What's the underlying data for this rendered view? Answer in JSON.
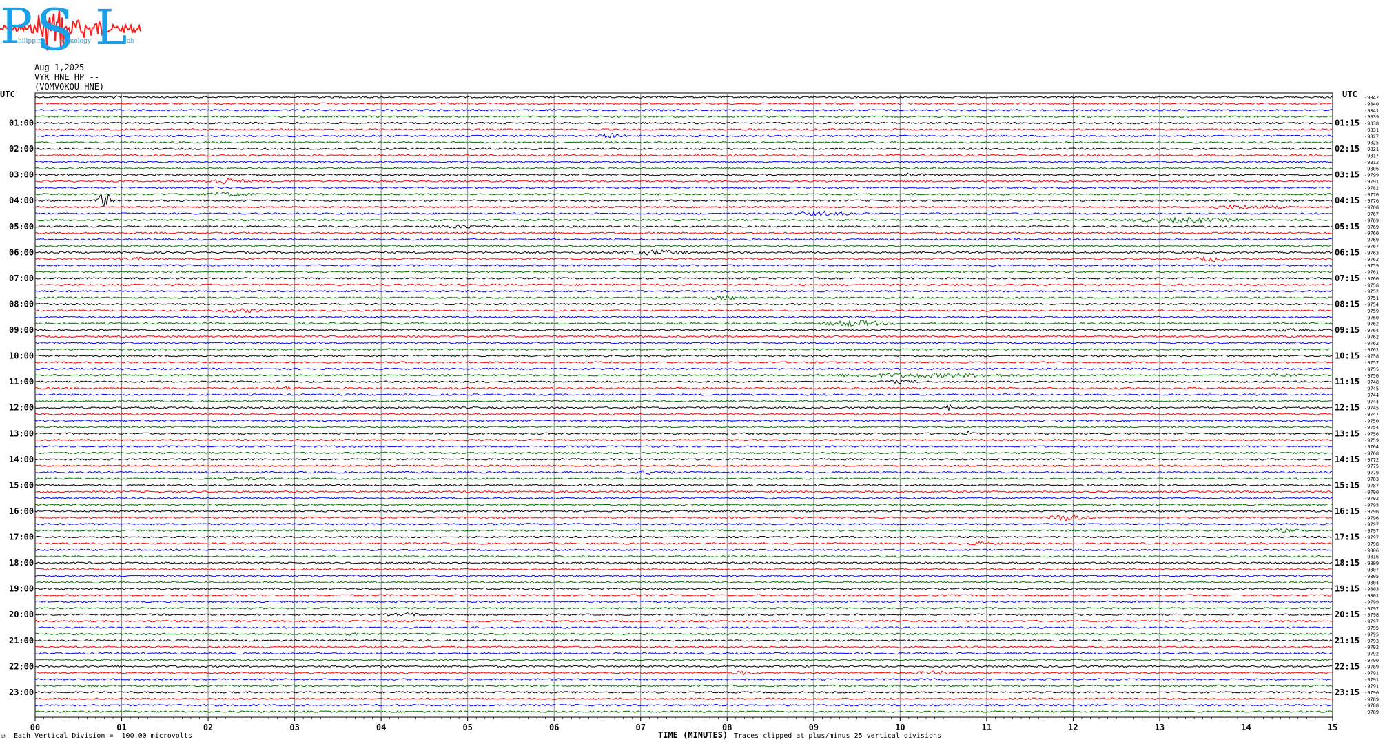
{
  "logo": {
    "letters": [
      "P",
      "S",
      "L"
    ],
    "subtitle_words": [
      "hilippine",
      "eismology",
      "ab"
    ],
    "color_text": "#1aa0e8",
    "color_wave": "#ff1a1a"
  },
  "header": {
    "date": "Aug 1,2025",
    "station": "VYK HNE HP --",
    "station_full": "(VOMVOKOU-HNE)"
  },
  "footer": {
    "scale_note": "Each Vertical Division =  100.00 microvolts",
    "corner_mark": "LM",
    "clip_note": "Traces clipped at plus/minus 25 vertical divisions"
  },
  "chart_data": {
    "type": "line",
    "title": "",
    "xlabel": "TIME (MINUTES)",
    "ylabel_left": "UTC",
    "ylabel_right": "UTC",
    "xlim": [
      0,
      15
    ],
    "x_ticks": [
      "00",
      "01",
      "02",
      "03",
      "04",
      "05",
      "06",
      "07",
      "08",
      "09",
      "10",
      "11",
      "12",
      "13",
      "14",
      "15"
    ],
    "trace_count": 96,
    "minutes_per_trace": 15,
    "trace_colors": [
      "#000000",
      "#ff0000",
      "#0000ff",
      "#007000"
    ],
    "left_hour_labels": [
      "UTC",
      "01:00",
      "02:00",
      "03:00",
      "04:00",
      "05:00",
      "06:00",
      "07:00",
      "08:00",
      "09:00",
      "10:00",
      "11:00",
      "12:00",
      "13:00",
      "14:00",
      "15:00",
      "16:00",
      "17:00",
      "18:00",
      "19:00",
      "20:00",
      "21:00",
      "22:00",
      "23:00"
    ],
    "right_hour_labels": [
      "UTC",
      "01:15",
      "02:15",
      "03:15",
      "04:15",
      "05:15",
      "06:15",
      "07:15",
      "08:15",
      "09:15",
      "10:15",
      "11:15",
      "12:15",
      "13:15",
      "14:15",
      "15:15",
      "16:15",
      "17:15",
      "18:15",
      "19:15",
      "20:15",
      "21:15",
      "22:15",
      "23:15"
    ],
    "trace_offsets": [
      -9842,
      -9840,
      -9841,
      -9839,
      -9838,
      -9831,
      -9827,
      -9825,
      -9821,
      -9817,
      -9812,
      -9806,
      -9799,
      -9791,
      -9782,
      -9770,
      -9776,
      -9768,
      -9767,
      -9769,
      -9769,
      -9760,
      -9769,
      -9767,
      -9763,
      -9762,
      -9759,
      -9761,
      -9760,
      -9758,
      -9752,
      -9751,
      -9754,
      -9759,
      -9760,
      -9762,
      -9764,
      -9762,
      -9762,
      -9761,
      -9758,
      -9757,
      -9755,
      -9750,
      -9748,
      -9745,
      -9744,
      -9744,
      -9745,
      -9747,
      -9750,
      -9754,
      -9756,
      -9759,
      -9764,
      -9768,
      -9772,
      -9775,
      -9779,
      -9783,
      -9787,
      -9790,
      -9792,
      -9795,
      -9796,
      -9796,
      -9797,
      -9797,
      -9797,
      -9798,
      -9806,
      -9816,
      -9809,
      -9807,
      -9805,
      -9804,
      -9803,
      -9801,
      -9799,
      -9797,
      -9798,
      -9797,
      -9795,
      -9795,
      -9793,
      -9792,
      -9792,
      -9790,
      -9789,
      -9791,
      -9791,
      -9791,
      -9790,
      -9789,
      -9788,
      -9789
    ],
    "events": [
      {
        "trace": 0,
        "minute": 0.9,
        "amp": 1.2,
        "width": 0.2
      },
      {
        "trace": 6,
        "minute": 6.65,
        "amp": 3,
        "width": 0.2
      },
      {
        "trace": 13,
        "minute": 2.2,
        "amp": 4,
        "width": 0.3
      },
      {
        "trace": 12,
        "minute": 10.1,
        "amp": 2,
        "width": 0.2
      },
      {
        "trace": 15,
        "minute": 2.25,
        "amp": 2.5,
        "width": 0.35
      },
      {
        "trace": 16,
        "minute": 0.8,
        "amp": 12,
        "width": 0.12
      },
      {
        "trace": 17,
        "minute": 14,
        "amp": 2.5,
        "width": 0.6
      },
      {
        "trace": 18,
        "minute": 9.1,
        "amp": 2,
        "width": 0.6
      },
      {
        "trace": 19,
        "minute": 13.3,
        "amp": 3,
        "width": 0.8
      },
      {
        "trace": 20,
        "minute": 5,
        "amp": 2,
        "width": 0.6
      },
      {
        "trace": 24,
        "minute": 7.15,
        "amp": 3,
        "width": 0.5
      },
      {
        "trace": 25,
        "minute": 1.1,
        "amp": 2,
        "width": 0.3
      },
      {
        "trace": 25,
        "minute": 13.6,
        "amp": 3,
        "width": 0.3
      },
      {
        "trace": 31,
        "minute": 8,
        "amp": 2,
        "width": 0.3
      },
      {
        "trace": 33,
        "minute": 2.4,
        "amp": 2,
        "width": 0.4
      },
      {
        "trace": 35,
        "minute": 9.5,
        "amp": 4,
        "width": 0.5
      },
      {
        "trace": 36,
        "minute": 14.5,
        "amp": 1.5,
        "width": 0.4
      },
      {
        "trace": 43,
        "minute": 10.3,
        "amp": 2.5,
        "width": 1.5
      },
      {
        "trace": 43,
        "minute": 14.4,
        "amp": 1.5,
        "width": 0.4
      },
      {
        "trace": 44,
        "minute": 10.0,
        "amp": 1.5,
        "width": 0.3
      },
      {
        "trace": 45,
        "minute": 2.9,
        "amp": 1.5,
        "width": 0.2
      },
      {
        "trace": 48,
        "minute": 10.57,
        "amp": 5,
        "width": 0.06
      },
      {
        "trace": 52,
        "minute": 10.8,
        "amp": 3,
        "width": 0.06
      },
      {
        "trace": 58,
        "minute": 7.1,
        "amp": 2,
        "width": 0.4
      },
      {
        "trace": 59,
        "minute": 2.4,
        "amp": 1.5,
        "width": 0.4
      },
      {
        "trace": 65,
        "minute": 11.95,
        "amp": 5,
        "width": 0.3
      },
      {
        "trace": 67,
        "minute": 14.4,
        "amp": 1.5,
        "width": 0.4
      },
      {
        "trace": 69,
        "minute": 10.9,
        "amp": 1.5,
        "width": 0.3
      },
      {
        "trace": 80,
        "minute": 4.3,
        "amp": 1.5,
        "width": 0.3
      },
      {
        "trace": 83,
        "minute": 3.7,
        "amp": 1.5,
        "width": 0.2
      },
      {
        "trace": 89,
        "minute": 8.2,
        "amp": 2,
        "width": 0.2
      },
      {
        "trace": 89,
        "minute": 10.4,
        "amp": 2,
        "width": 0.3
      }
    ]
  }
}
